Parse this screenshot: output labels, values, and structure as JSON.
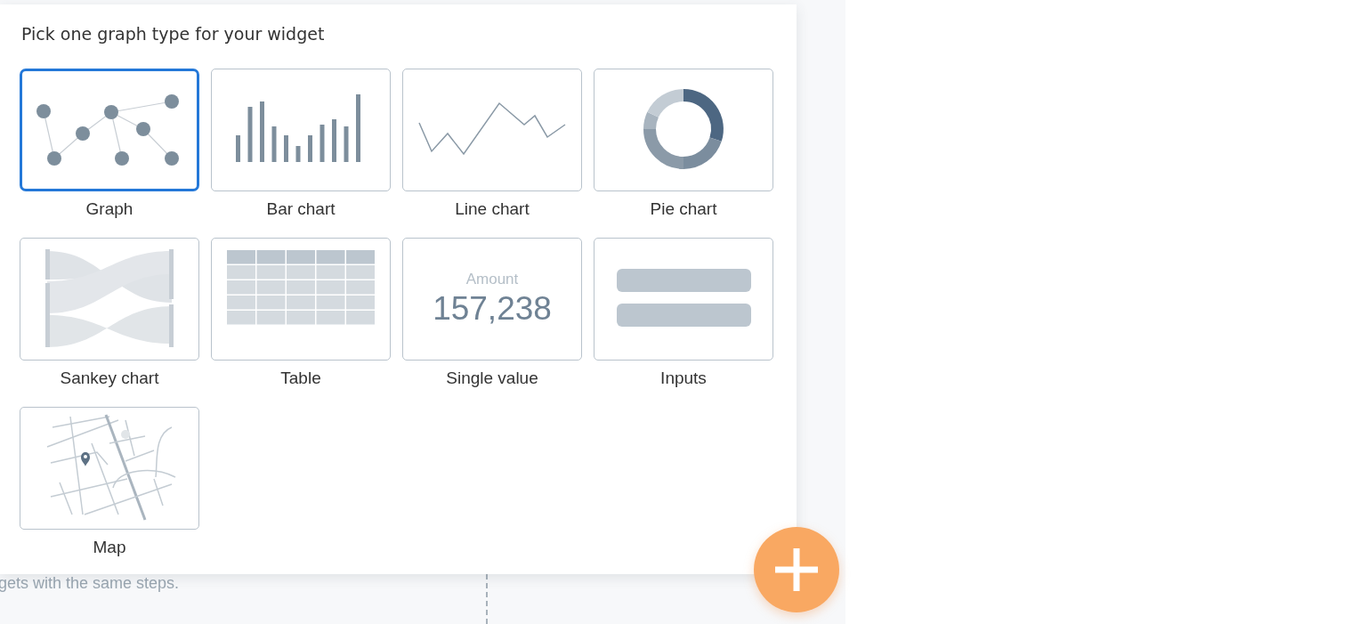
{
  "dialog": {
    "title": "Pick one graph type for your widget",
    "types": [
      {
        "label": "Graph",
        "kind": "graph",
        "selected": true
      },
      {
        "label": "Bar chart",
        "kind": "bar",
        "selected": false
      },
      {
        "label": "Line chart",
        "kind": "line",
        "selected": false
      },
      {
        "label": "Pie chart",
        "kind": "pie",
        "selected": false
      },
      {
        "label": "Sankey chart",
        "kind": "sankey",
        "selected": false
      },
      {
        "label": "Table",
        "kind": "table",
        "selected": false
      },
      {
        "label": "Single value",
        "kind": "single_value",
        "selected": false,
        "caption": "Amount",
        "value": "157,238"
      },
      {
        "label": "Inputs",
        "kind": "inputs",
        "selected": false
      },
      {
        "label": "Map",
        "kind": "map",
        "selected": false
      }
    ]
  },
  "background": {
    "hint": "gets with the same steps."
  }
}
